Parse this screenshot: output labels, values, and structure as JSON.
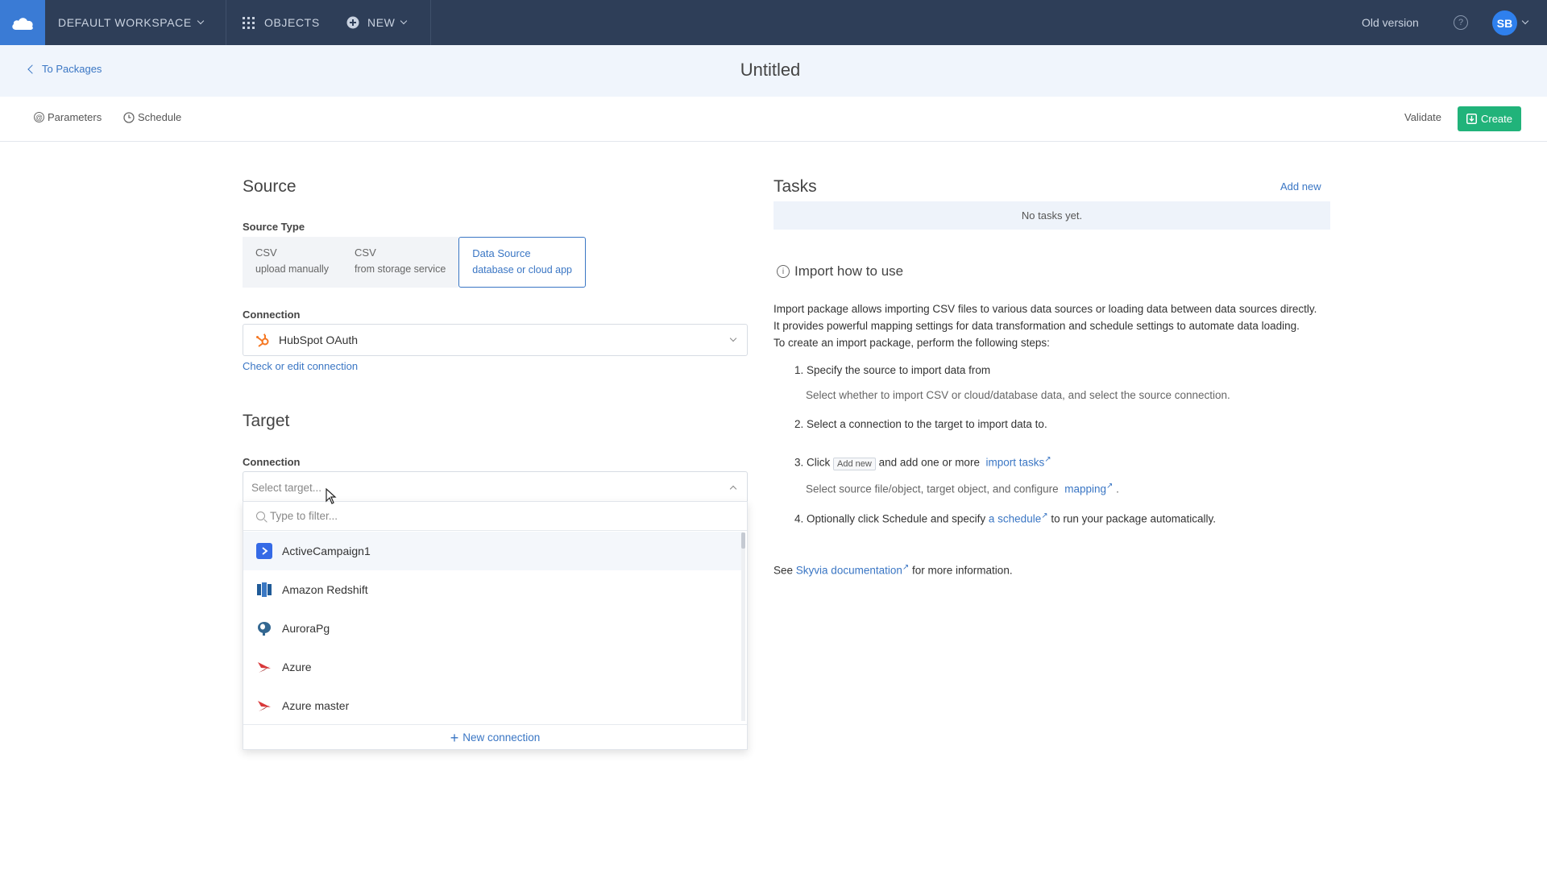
{
  "topbar": {
    "workspace": "DEFAULT WORKSPACE",
    "objects": "OBJECTS",
    "new": "NEW",
    "old_version": "Old version",
    "avatar_initials": "SB"
  },
  "titlebar": {
    "back_label": "To Packages",
    "title": "Untitled"
  },
  "toolbar": {
    "parameters": "Parameters",
    "schedule": "Schedule",
    "validate": "Validate",
    "create": "Create"
  },
  "source": {
    "title": "Source",
    "type_label": "Source Type",
    "types": [
      {
        "label": "CSV",
        "sub": "upload manually",
        "active": false
      },
      {
        "label": "CSV",
        "sub": "from storage service",
        "active": false
      },
      {
        "label": "Data Source",
        "sub": "database or cloud app",
        "active": true
      }
    ],
    "connection_label": "Connection",
    "connection_value": "HubSpot OAuth",
    "check_link": "Check or edit connection"
  },
  "target": {
    "title": "Target",
    "connection_label": "Connection",
    "placeholder": "Select target...",
    "filter_placeholder": "Type to filter...",
    "options": [
      "ActiveCampaign1",
      "Amazon Redshift",
      "AuroraPg",
      "Azure",
      "Azure master"
    ],
    "new_connection": "New connection"
  },
  "tasks": {
    "title": "Tasks",
    "add_new": "Add new",
    "empty": "No tasks yet."
  },
  "howto": {
    "title": "Import how to use",
    "intro1": "Import package allows importing CSV files to various data sources or loading data between data sources directly.",
    "intro2": "It provides powerful mapping settings for data transformation and schedule settings to automate data loading.",
    "intro3": "To create an import package, perform the following steps:",
    "step1": "1. Specify the source to import data from",
    "step1_sub": "Select whether to import CSV or cloud/database data, and select the source connection.",
    "step2": "2. Select a connection to the target to import data to.",
    "step3_a": "3. Click",
    "step3_kbd": "Add new",
    "step3_b": "and add one or more",
    "step3_link": "import tasks",
    "step3_sub_a": "Select source file/object, target object, and configure",
    "step3_sub_link": "mapping",
    "step3_sub_b": ".",
    "step4_a": "4. Optionally click Schedule and specify",
    "step4_link": "a schedule",
    "step4_b": "to run your package automatically.",
    "see_a": "See",
    "see_link": "Skyvia documentation",
    "see_b": "for more information."
  }
}
